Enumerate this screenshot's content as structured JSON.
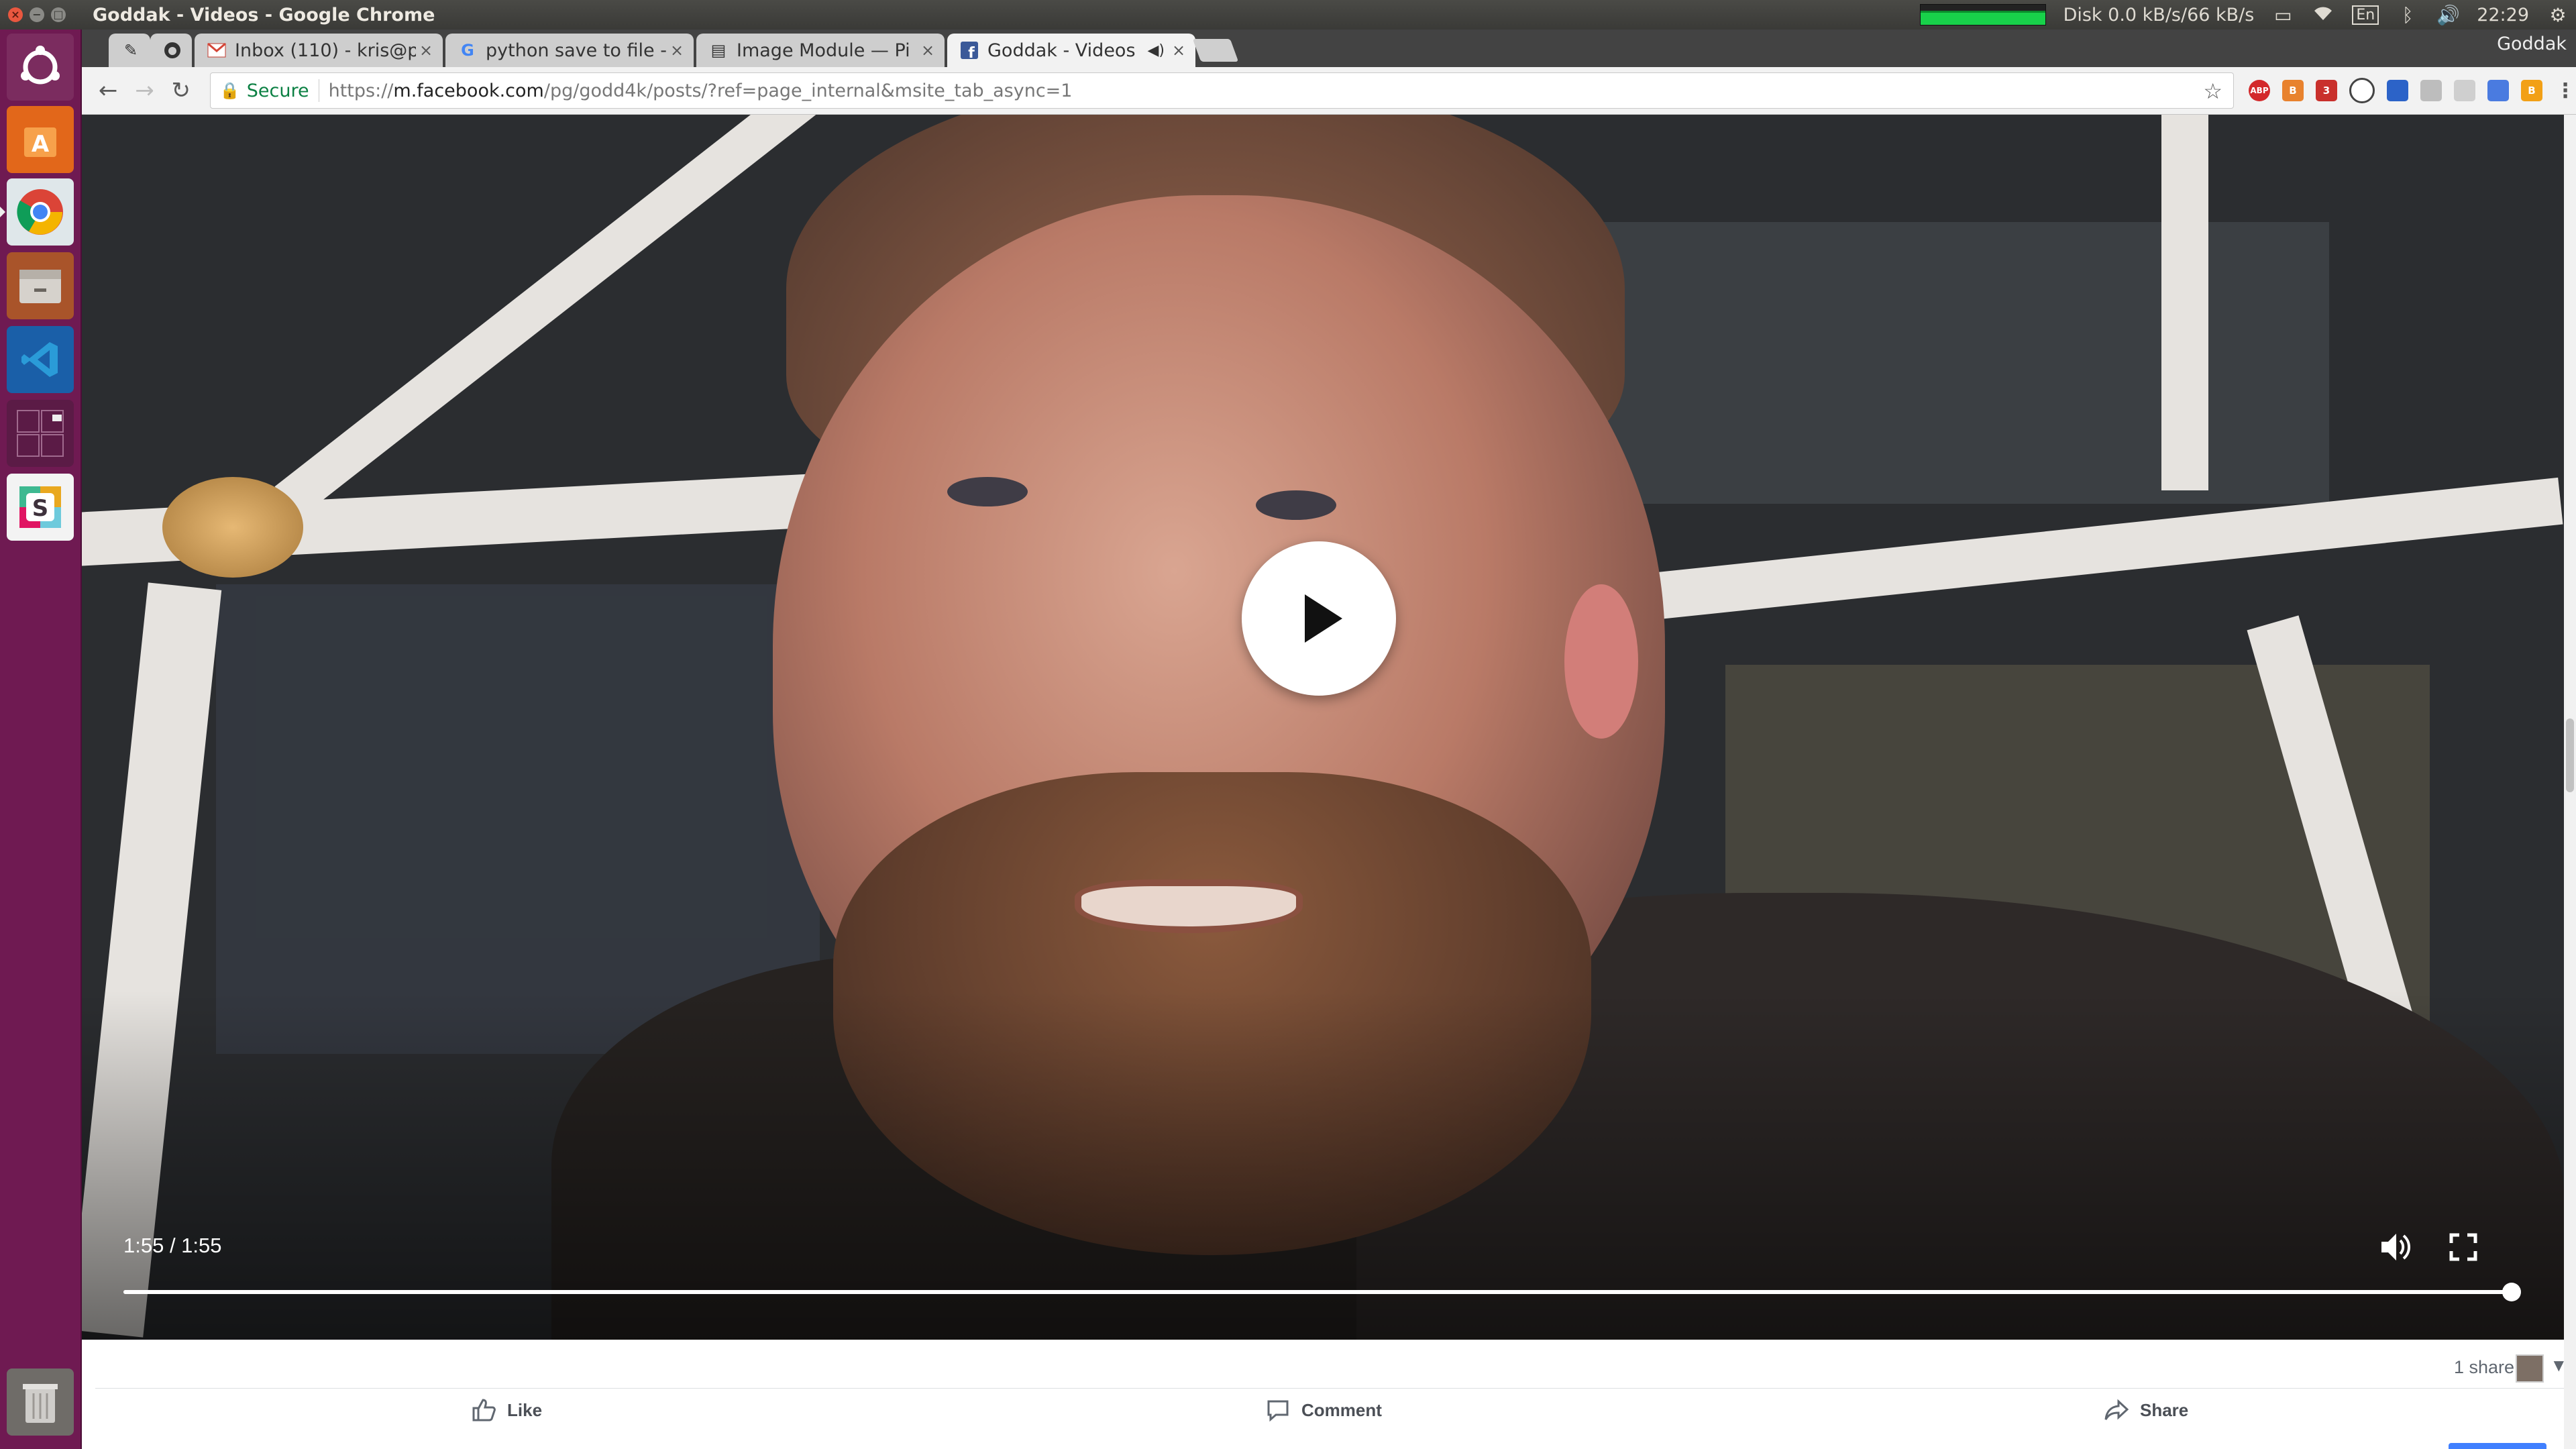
{
  "window": {
    "title": "Goddak - Videos - Google Chrome"
  },
  "topbar": {
    "disk_label": "Disk 0.0 kB/s/66 kB/s",
    "keyboard_layout": "En",
    "clock": "22:29"
  },
  "launcher": {
    "items": [
      "ubuntu-dash",
      "software-center",
      "chrome",
      "files",
      "vscode",
      "workspace-switcher",
      "slack",
      "trash"
    ]
  },
  "tabs": [
    {
      "title": "",
      "icon": "pen-icon"
    },
    {
      "title": "",
      "icon": "github-icon"
    },
    {
      "title": "Inbox (110) - kris@p",
      "icon": "gmail-icon"
    },
    {
      "title": "python save to file -",
      "icon": "google-icon"
    },
    {
      "title": "Image Module — Pi",
      "icon": "doc-icon"
    },
    {
      "title": "Goddak - Videos",
      "icon": "facebook-icon",
      "active": true
    }
  ],
  "profile_name": "Goddak",
  "toolbar": {
    "secure_label": "Secure",
    "url_prefix": "https://",
    "url_host": "m.facebook.com",
    "url_path": "/pg/godd4k/posts/?ref=page_internal&msite_tab_async=1",
    "extensions": [
      "ABP",
      "B",
      "3",
      "",
      "",
      "",
      "",
      "B"
    ]
  },
  "video": {
    "time_display": "1:55 / 1:55",
    "progress_fraction": 1.0
  },
  "post": {
    "share_count": "1 share",
    "actions": {
      "like": "Like",
      "comment": "Comment",
      "share": "Share"
    }
  },
  "colors": {
    "ubuntu_bar": "#3c3b37",
    "launcher": "#6f1a52",
    "tab_active": "#f2f2f2",
    "secure_green": "#0b8043",
    "facebook_blue": "#4080ff"
  }
}
